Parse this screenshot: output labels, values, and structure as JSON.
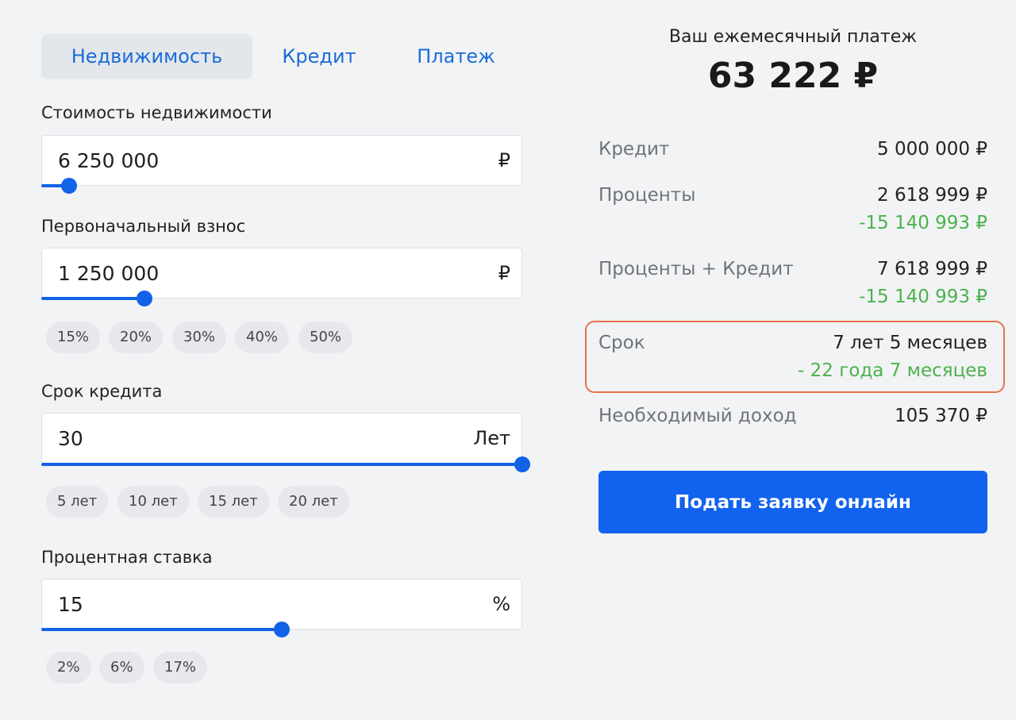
{
  "tabs": [
    {
      "label": "Недвижимость",
      "active": true
    },
    {
      "label": "Кредит",
      "active": false
    },
    {
      "label": "Платеж",
      "active": false
    }
  ],
  "fields": {
    "property_cost": {
      "label": "Стоимость недвижимости",
      "value": "6 250 000",
      "unit": "₽",
      "slider_fraction": 0.057
    },
    "down_payment": {
      "label": "Первоначальный взнос",
      "value": "1 250 000",
      "unit": "₽",
      "slider_fraction": 0.215,
      "chips": [
        "15%",
        "20%",
        "30%",
        "40%",
        "50%"
      ]
    },
    "loan_term": {
      "label": "Срок кредита",
      "value": "30",
      "unit": "Лет",
      "slider_fraction": 1.0,
      "chips": [
        "5 лет",
        "10 лет",
        "15 лет",
        "20 лет"
      ]
    },
    "interest_rate": {
      "label": "Процентная ставка",
      "value": "15",
      "unit": "%",
      "slider_fraction": 0.5,
      "chips": [
        "2%",
        "6%",
        "17%"
      ]
    }
  },
  "summary": {
    "title": "Ваш ежемесячный платеж",
    "amount": "63 222 ₽",
    "rows": {
      "credit": {
        "label": "Кредит",
        "value": "5 000 000 ₽"
      },
      "interest": {
        "label": "Проценты",
        "value": "2 618 999 ₽",
        "delta": "-15 140 993 ₽"
      },
      "total": {
        "label": "Проценты + Кредит",
        "value": "7 618 999 ₽",
        "delta": "-15 140 993 ₽"
      },
      "term": {
        "label": "Срок",
        "value": "7 лет 5 месяцев",
        "delta": "- 22 года 7 месяцев"
      },
      "income": {
        "label": "Необходимый доход",
        "value": "105 370 ₽"
      }
    },
    "apply_button": "Подать заявку онлайн"
  },
  "colors": {
    "accent": "#1262e8",
    "positive": "#4cb24c",
    "highlight": "#e4734f",
    "background": "#f2f3f5"
  }
}
